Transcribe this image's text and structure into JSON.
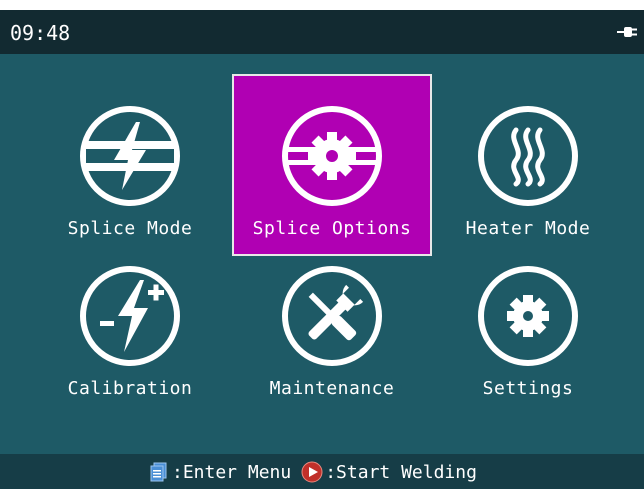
{
  "status": {
    "time": "09:48",
    "power_icon": "power-plug-icon"
  },
  "menu": {
    "items": [
      {
        "label": "Splice Mode",
        "icon": "splice-mode-icon",
        "selected": false
      },
      {
        "label": "Splice Options",
        "icon": "splice-options-icon",
        "selected": true
      },
      {
        "label": "Heater Mode",
        "icon": "heater-icon",
        "selected": false
      },
      {
        "label": "Calibration",
        "icon": "calibration-icon",
        "selected": false
      },
      {
        "label": "Maintenance",
        "icon": "maintenance-icon",
        "selected": false
      },
      {
        "label": "Settings",
        "icon": "settings-gear-icon",
        "selected": false
      }
    ]
  },
  "hints": {
    "menu_key_text": ":Enter Menu",
    "start_key_text": ":Start Welding",
    "menu_key_icon": "menu-key-icon",
    "start_key_icon": "start-key-icon"
  },
  "colors": {
    "background": "#1e5a66",
    "status_bar": "#122a31",
    "selection": "#b000b3",
    "bottom_bar": "#163d47",
    "menu_key": "#4a8fd6",
    "start_key": "#c0302a"
  }
}
